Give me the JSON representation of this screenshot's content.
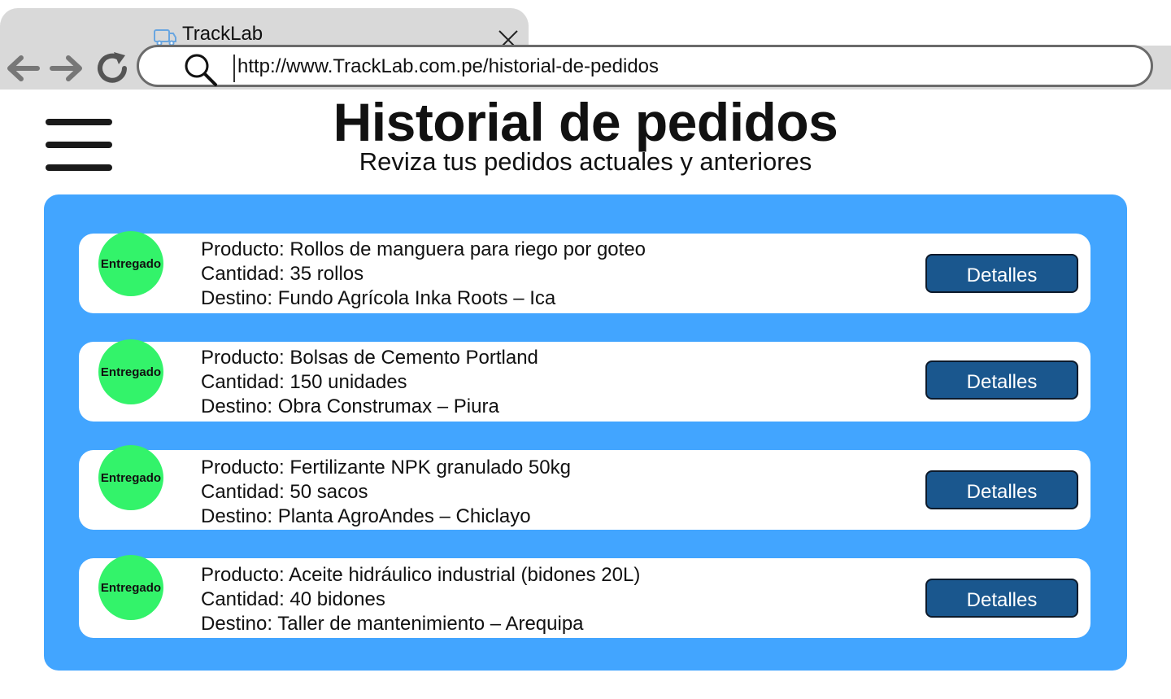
{
  "browser": {
    "tab_title": "TrackLab",
    "url": "http://www.TrackLab.com.pe/historial-de-pedidos"
  },
  "page": {
    "title": "Historial de pedidos",
    "subtitle": "Reviza tus pedidos actuales y anteriores"
  },
  "orders": [
    {
      "status": "Entregado",
      "product": "Producto: Rollos de manguera para riego por goteo",
      "quantity": "Cantidad: 35 rollos",
      "destination": "Destino: Fundo Agrícola Inka Roots – Ica",
      "button_label": "Detalles"
    },
    {
      "status": "Entregado",
      "product": "Producto: Bolsas de Cemento Portland",
      "quantity": "Cantidad: 150 unidades",
      "destination": "Destino: Obra Construmax – Piura",
      "button_label": "Detalles"
    },
    {
      "status": "Entregado",
      "product": "Producto: Fertilizante NPK granulado 50kg",
      "quantity": "Cantidad: 50 sacos",
      "destination": "Destino: Planta AgroAndes – Chiclayo",
      "button_label": "Detalles"
    },
    {
      "status": "Entregado",
      "product": "Producto: Aceite hidráulico industrial (bidones 20L)",
      "quantity": "Cantidad: 40 bidones",
      "destination": "Destino: Taller de mantenimiento – Arequipa",
      "button_label": "Detalles"
    }
  ],
  "colors": {
    "panel": "#42a5ff",
    "status_badge": "#33f36a",
    "button": "#1a578e"
  },
  "icons": [
    "truck-icon",
    "close-icon",
    "back-arrow-icon",
    "forward-arrow-icon",
    "reload-icon",
    "search-icon",
    "hamburger-menu-icon"
  ]
}
